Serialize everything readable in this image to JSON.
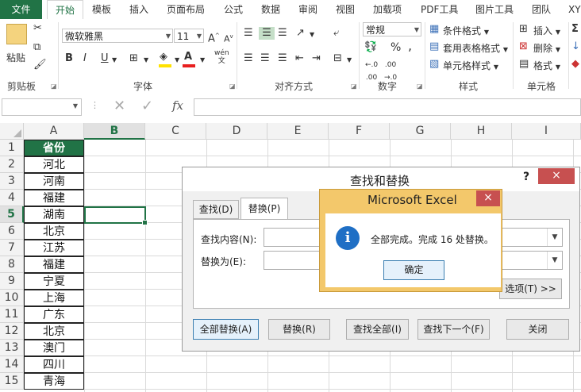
{
  "ribbon_tabs": [
    "文件",
    "开始",
    "模板",
    "插入",
    "页面布局",
    "公式",
    "数据",
    "审阅",
    "视图",
    "加载项",
    "PDF工具",
    "图片工具",
    "团队",
    "XY"
  ],
  "clipboard": {
    "paste": "粘贴",
    "group": "剪贴板"
  },
  "font": {
    "name": "微软雅黑",
    "size": "11",
    "grow": "A",
    "shrink": "A",
    "bold": "B",
    "italic": "I",
    "underline": "U",
    "wen": "wén",
    "group": "字体"
  },
  "align": {
    "group": "对齐方式"
  },
  "number": {
    "format": "常规",
    "percent": "%",
    "comma": ",",
    "group": "数字"
  },
  "styles": {
    "cond": "条件格式",
    "table": "套用表格格式",
    "cell": "单元格样式",
    "group": "样式"
  },
  "cells": {
    "insert": "插入",
    "delete": "删除",
    "format": "格式",
    "group": "单元格"
  },
  "formula_bar": {
    "fx": "fx",
    "value": ""
  },
  "grid": {
    "columns": [
      "A",
      "B",
      "C",
      "D",
      "E",
      "F",
      "G",
      "H",
      "I"
    ],
    "selected_col": "B",
    "rows": [
      "1",
      "2",
      "3",
      "4",
      "5",
      "6",
      "7",
      "8",
      "9",
      "10",
      "11",
      "12",
      "13",
      "14",
      "15"
    ],
    "selected_row": "5",
    "colA": [
      "省份",
      "河北",
      "河南",
      "福建",
      "湖南",
      "北京",
      "江苏",
      "福建",
      "宁夏",
      "上海",
      "广东",
      "北京",
      "澳门",
      "四川",
      "青海"
    ]
  },
  "find_dialog": {
    "title": "查找和替换",
    "help": "?",
    "close": "×",
    "tab_find": "查找(D)",
    "tab_replace": "替换(P)",
    "find_label": "查找内容(N):",
    "replace_label": "替换为(E):",
    "options": "选项(T) >>",
    "btn_replace_all": "全部替换(A)",
    "btn_replace": "替换(R)",
    "btn_find_all": "查找全部(I)",
    "btn_find_next": "查找下一个(F)",
    "btn_close": "关闭"
  },
  "msgbox": {
    "title": "Microsoft Excel",
    "close": "×",
    "icon": "i",
    "message": "全部完成。完成 16 处替换。",
    "ok": "确定"
  },
  "colors": {
    "excel_green": "#217346",
    "msg_frame": "#f3c86b",
    "msg_close": "#c75050",
    "dlg_close": "#c75050"
  }
}
